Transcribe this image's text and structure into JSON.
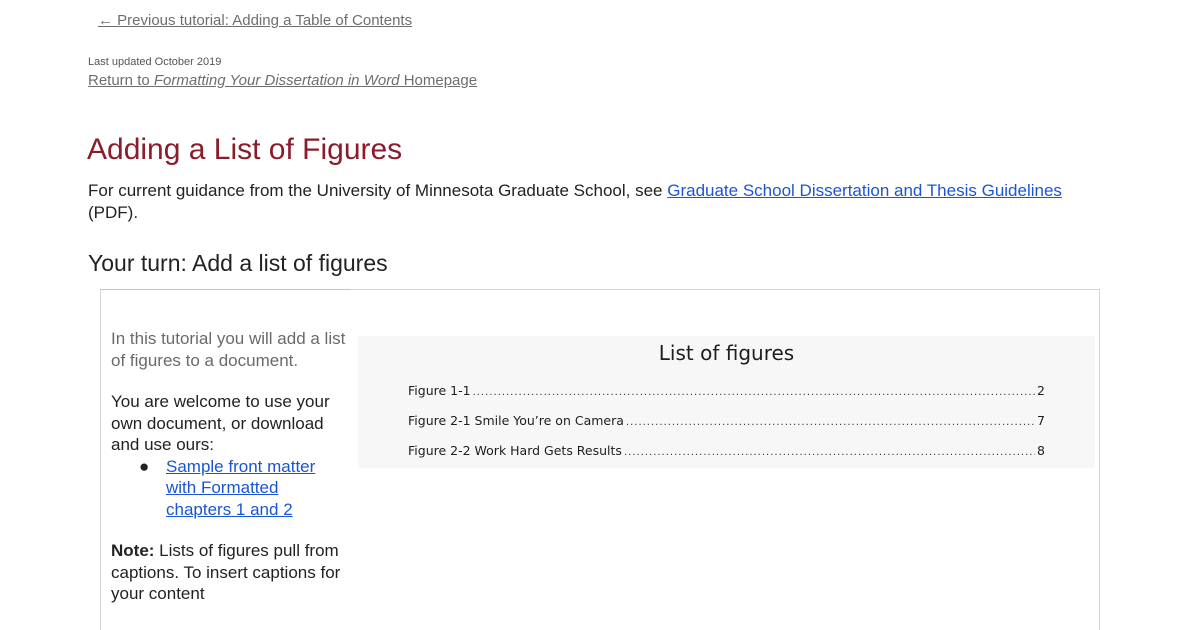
{
  "nav": {
    "previous_link": "← Previous tutorial: Adding a Table of Contents"
  },
  "meta": {
    "last_updated": "Last updated October 2019",
    "return_prefix": "Return to ",
    "return_emphasis": "Formatting Your Dissertation in Word",
    "return_suffix": " Homepage"
  },
  "main": {
    "title": "Adding a List of Figures",
    "intro_text": "For current guidance from the University of Minnesota Graduate School, see ",
    "intro_link": "Graduate School Dissertation and Thesis Guidelines",
    "intro_suffix": " (PDF).",
    "subtitle": "Your turn: Add a list of figures"
  },
  "sidebar": {
    "paragraph1": "In this tutorial you will add a list of figures to a document.",
    "paragraph2": "You are welcome to use your own document, or download and use ours:",
    "download_link": "Sample front matter with Formatted chapters 1 and 2",
    "note_label": "Note:",
    "note_text": " Lists of figures pull from captions. To insert captions for your content"
  },
  "preview": {
    "title": "List of figures",
    "entries": [
      {
        "label": "Figure 1-1 ",
        "page": "2"
      },
      {
        "label": "Figure 2-1 Smile You’re on Camera",
        "page": "7"
      },
      {
        "label": "Figure 2-2 Work Hard Gets Results ",
        "page": "8"
      }
    ]
  },
  "colors": {
    "title": "#8a1c2b",
    "link": "#1a55d6",
    "muted_link": "#6e6e6e"
  }
}
